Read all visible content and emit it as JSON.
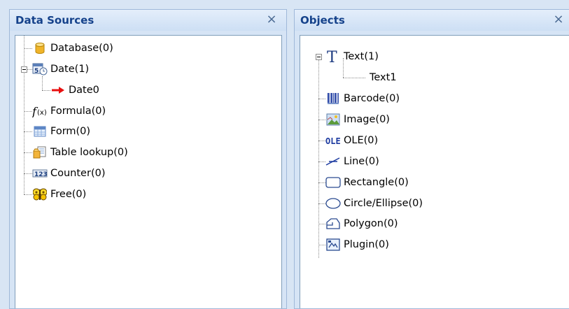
{
  "data_sources": {
    "title": "Data Sources",
    "close": "×",
    "items": [
      {
        "label": "Database(0)",
        "icon": "database-icon"
      },
      {
        "label": "Date(1)",
        "icon": "date-icon",
        "expanded": true
      },
      {
        "label": "Date0",
        "icon": "red-arrow-icon"
      },
      {
        "label": "Formula(0)",
        "icon": "formula-icon"
      },
      {
        "label": "Form(0)",
        "icon": "form-icon"
      },
      {
        "label": "Table lookup(0)",
        "icon": "table-lookup-icon"
      },
      {
        "label": "Counter(0)",
        "icon": "counter-icon"
      },
      {
        "label": "Free(0)",
        "icon": "free-icon"
      }
    ]
  },
  "objects": {
    "title": "Objects",
    "close": "×",
    "items": [
      {
        "label": "Text(1)",
        "icon": "text-icon",
        "expanded": true
      },
      {
        "label": "Text1",
        "icon": ""
      },
      {
        "label": "Barcode(0)",
        "icon": "barcode-icon"
      },
      {
        "label": "Image(0)",
        "icon": "image-icon"
      },
      {
        "label": "OLE(0)",
        "icon": "ole-icon"
      },
      {
        "label": "Line(0)",
        "icon": "line-icon"
      },
      {
        "label": "Rectangle(0)",
        "icon": "rectangle-icon"
      },
      {
        "label": "Circle/Ellipse(0)",
        "icon": "ellipse-icon"
      },
      {
        "label": "Polygon(0)",
        "icon": "polygon-icon"
      },
      {
        "label": "Plugin(0)",
        "icon": "plugin-icon"
      }
    ]
  }
}
